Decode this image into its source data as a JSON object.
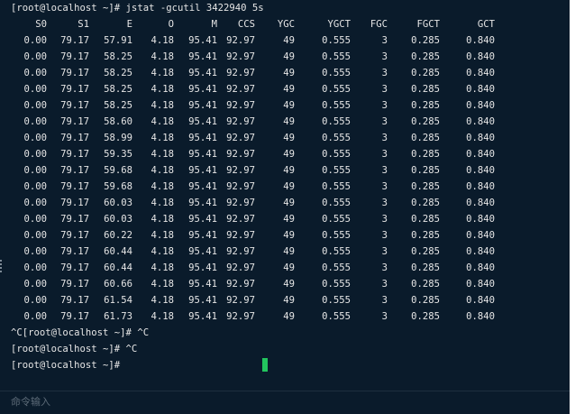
{
  "terminal": {
    "command_line": "[root@localhost ~]# jstat -gcutil 3422940 5s",
    "headers": [
      "S0",
      "S1",
      "E",
      "O",
      "M",
      "CCS",
      "YGC",
      "YGCT",
      "FGC",
      "FGCT",
      "GCT"
    ],
    "rows": [
      [
        "0.00",
        "79.17",
        "57.91",
        "4.18",
        "95.41",
        "92.97",
        "49",
        "0.555",
        "3",
        "0.285",
        "0.840"
      ],
      [
        "0.00",
        "79.17",
        "58.25",
        "4.18",
        "95.41",
        "92.97",
        "49",
        "0.555",
        "3",
        "0.285",
        "0.840"
      ],
      [
        "0.00",
        "79.17",
        "58.25",
        "4.18",
        "95.41",
        "92.97",
        "49",
        "0.555",
        "3",
        "0.285",
        "0.840"
      ],
      [
        "0.00",
        "79.17",
        "58.25",
        "4.18",
        "95.41",
        "92.97",
        "49",
        "0.555",
        "3",
        "0.285",
        "0.840"
      ],
      [
        "0.00",
        "79.17",
        "58.25",
        "4.18",
        "95.41",
        "92.97",
        "49",
        "0.555",
        "3",
        "0.285",
        "0.840"
      ],
      [
        "0.00",
        "79.17",
        "58.60",
        "4.18",
        "95.41",
        "92.97",
        "49",
        "0.555",
        "3",
        "0.285",
        "0.840"
      ],
      [
        "0.00",
        "79.17",
        "58.99",
        "4.18",
        "95.41",
        "92.97",
        "49",
        "0.555",
        "3",
        "0.285",
        "0.840"
      ],
      [
        "0.00",
        "79.17",
        "59.35",
        "4.18",
        "95.41",
        "92.97",
        "49",
        "0.555",
        "3",
        "0.285",
        "0.840"
      ],
      [
        "0.00",
        "79.17",
        "59.68",
        "4.18",
        "95.41",
        "92.97",
        "49",
        "0.555",
        "3",
        "0.285",
        "0.840"
      ],
      [
        "0.00",
        "79.17",
        "59.68",
        "4.18",
        "95.41",
        "92.97",
        "49",
        "0.555",
        "3",
        "0.285",
        "0.840"
      ],
      [
        "0.00",
        "79.17",
        "60.03",
        "4.18",
        "95.41",
        "92.97",
        "49",
        "0.555",
        "3",
        "0.285",
        "0.840"
      ],
      [
        "0.00",
        "79.17",
        "60.03",
        "4.18",
        "95.41",
        "92.97",
        "49",
        "0.555",
        "3",
        "0.285",
        "0.840"
      ],
      [
        "0.00",
        "79.17",
        "60.22",
        "4.18",
        "95.41",
        "92.97",
        "49",
        "0.555",
        "3",
        "0.285",
        "0.840"
      ],
      [
        "0.00",
        "79.17",
        "60.44",
        "4.18",
        "95.41",
        "92.97",
        "49",
        "0.555",
        "3",
        "0.285",
        "0.840"
      ],
      [
        "0.00",
        "79.17",
        "60.44",
        "4.18",
        "95.41",
        "92.97",
        "49",
        "0.555",
        "3",
        "0.285",
        "0.840"
      ],
      [
        "0.00",
        "79.17",
        "60.66",
        "4.18",
        "95.41",
        "92.97",
        "49",
        "0.555",
        "3",
        "0.285",
        "0.840"
      ],
      [
        "0.00",
        "79.17",
        "61.54",
        "4.18",
        "95.41",
        "92.97",
        "49",
        "0.555",
        "3",
        "0.285",
        "0.840"
      ],
      [
        "0.00",
        "79.17",
        "61.73",
        "4.18",
        "95.41",
        "92.97",
        "49",
        "0.555",
        "3",
        "0.285",
        "0.840"
      ]
    ],
    "after_lines": [
      "^C[root@localhost ~]# ^C",
      "[root@localhost ~]# ^C",
      "[root@localhost ~]#"
    ],
    "cursor_color": "#22c55e",
    "background_color": "#0a1b2b",
    "text_color": "#e6e6e6"
  },
  "command_bar": {
    "placeholder": "命令输入"
  }
}
